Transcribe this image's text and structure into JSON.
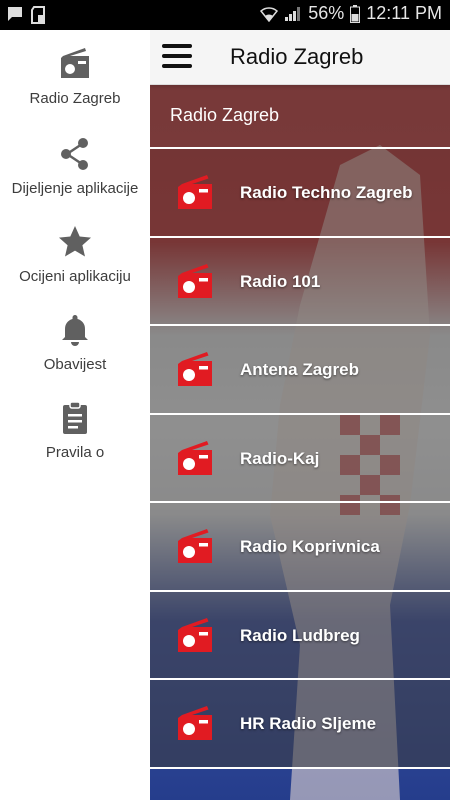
{
  "status_bar": {
    "battery_percent": "56%",
    "time": "12:11 PM",
    "icons": [
      "chat-icon",
      "sd-card-icon",
      "wifi-icon",
      "signal-icon",
      "battery-icon"
    ]
  },
  "toolbar": {
    "title": "Radio Zagreb",
    "menu_icon": "hamburger-icon"
  },
  "drawer": {
    "items": [
      {
        "label": "Radio Zagreb",
        "icon": "radio-icon"
      },
      {
        "label": "Dijeljenje aplikacije",
        "icon": "share-icon"
      },
      {
        "label": "Ocijeni aplikaciju",
        "icon": "star-icon"
      },
      {
        "label": "Obavijest",
        "icon": "bell-icon"
      },
      {
        "label": "Pravila o",
        "icon": "clipboard-icon"
      }
    ]
  },
  "list": {
    "header": "Radio Zagreb",
    "stations": [
      {
        "label": "Radio Techno Zagreb"
      },
      {
        "label": "Radio 101"
      },
      {
        "label": "Antena Zagreb"
      },
      {
        "label": "Radio-Kaj"
      },
      {
        "label": "Radio Koprivnica"
      },
      {
        "label": "Radio Ludbreg"
      },
      {
        "label": "HR Radio Sljeme"
      }
    ],
    "station_icon": "radio-icon"
  },
  "colors": {
    "accent_red": "#e11b22",
    "drawer_icon_gray": "#606060",
    "toolbar_bg": "#f5f5f5"
  }
}
